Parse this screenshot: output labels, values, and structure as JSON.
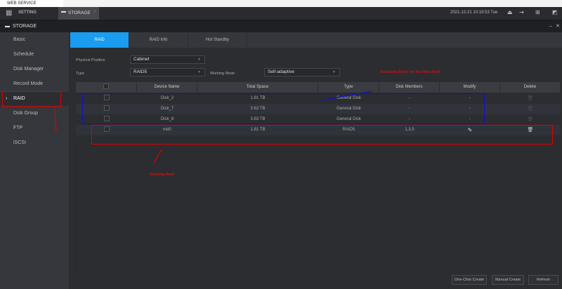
{
  "browser": {
    "tab_title": "WEB SERVICE"
  },
  "topbar": {
    "setting_label": "SETTING",
    "storage_tab_label": "STORAGE",
    "datetime": "2021-12-21 10:19:53 Tue"
  },
  "header": {
    "title": "STORAGE"
  },
  "sidebar": {
    "items": [
      {
        "label": "Basic"
      },
      {
        "label": "Schedule"
      },
      {
        "label": "Disk Manager"
      },
      {
        "label": "Record Mode"
      },
      {
        "label": "RAID",
        "active": true
      },
      {
        "label": "Disk Group"
      },
      {
        "label": "FTP"
      },
      {
        "label": "iSCSI"
      }
    ]
  },
  "tabs": [
    {
      "label": "RAID",
      "active": true
    },
    {
      "label": "RAID Info"
    },
    {
      "label": "Hot Standby"
    }
  ],
  "form": {
    "physical_position_label": "Physical Position",
    "physical_position": "Cabinet",
    "type_label": "Type",
    "type": "RAID5",
    "working_mode_label": "Working Mode",
    "working_mode": "Self-adaptive"
  },
  "table": {
    "headers": [
      "",
      "Device Name",
      "Total Space",
      "Type",
      "Disk Members",
      "Modify",
      "Delete"
    ],
    "rows": [
      {
        "name": "Disk_2",
        "space": "1.81 TB",
        "type": "General Disk",
        "members": "-",
        "modify": "-"
      },
      {
        "name": "Disk_7",
        "space": "3.63 TB",
        "type": "General Disk",
        "members": "-",
        "modify": "-"
      },
      {
        "name": "Disk_8",
        "space": "3.63 TB",
        "type": "General Disk",
        "members": "-",
        "modify": "-"
      },
      {
        "name": "md0",
        "space": "1.81 TB",
        "type": "RAID5",
        "members": "1,3,5",
        "modify": ""
      }
    ]
  },
  "buttons": {
    "one_click": "One-Click Create",
    "manual": "Manual Create",
    "refresh": "Refresh"
  },
  "annotations": {
    "available": "Available Disks for the New Raid",
    "existing": "Existing Raid"
  },
  "colors": {
    "accent": "#1a9cf0",
    "annotation_red": "#e00000",
    "annotation_blue": "#1010d0"
  }
}
